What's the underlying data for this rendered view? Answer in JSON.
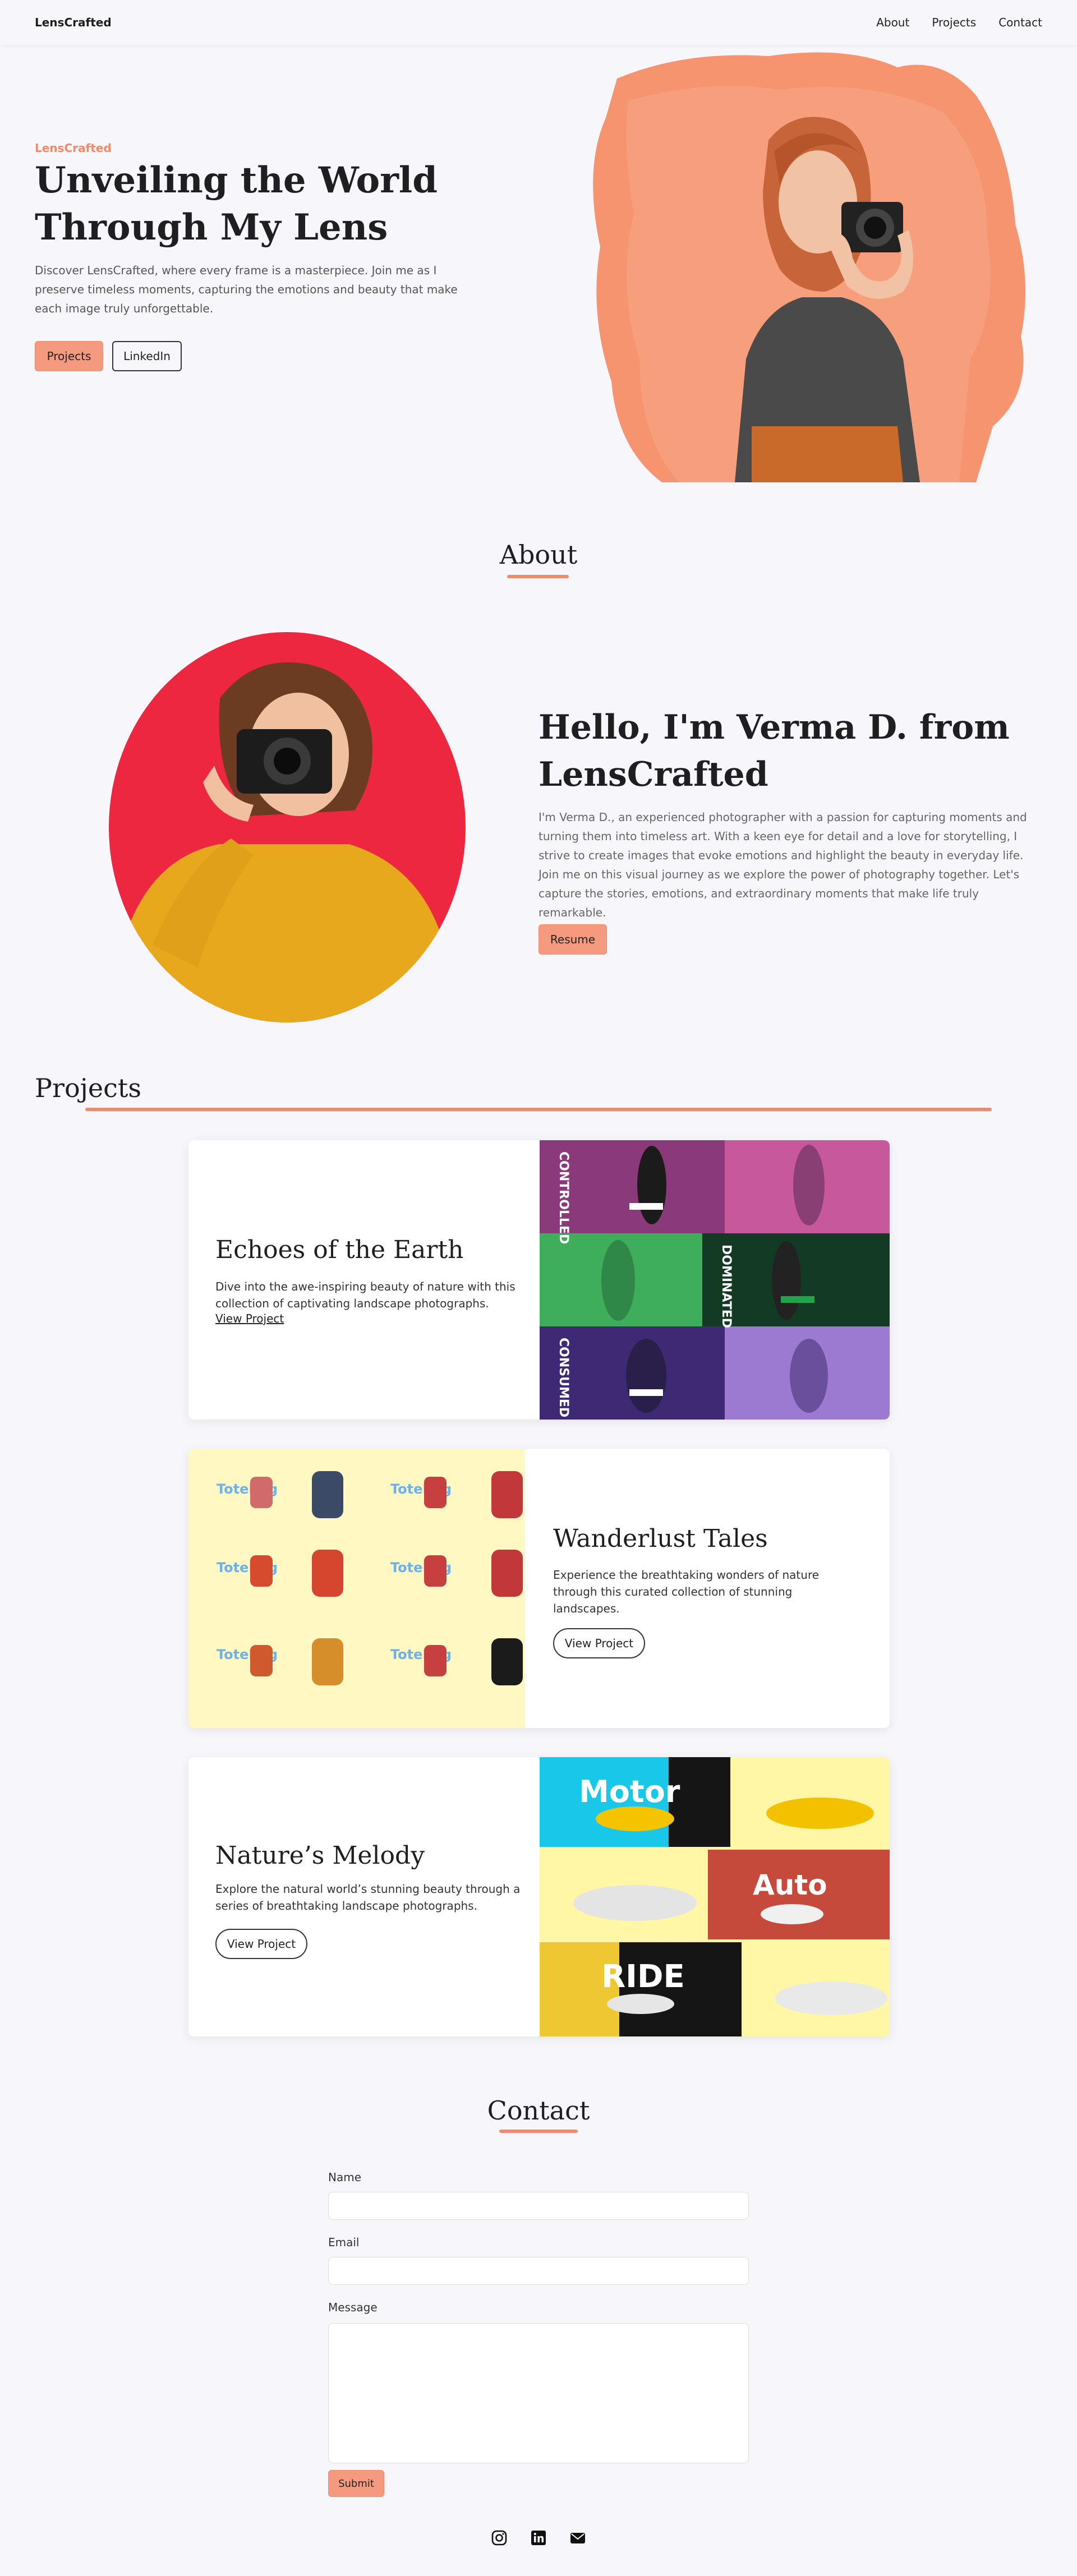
{
  "nav": {
    "logo": "LensCrafted",
    "links": [
      "About",
      "Projects",
      "Contact"
    ]
  },
  "hero": {
    "eyebrow": "LensCrafted",
    "title": "Unveiling the World Through My Lens",
    "description": "Discover LensCrafted, where every frame is a masterpiece. Join me as I preserve timeless moments, capturing the emotions and beauty that make each image truly unforgettable.",
    "primary_button": "Projects",
    "secondary_button": "LinkedIn"
  },
  "about": {
    "section_title": "About",
    "heading": "Hello, I'm Verma D. from LensCrafted",
    "description": "I'm Verma D., an experienced photographer with a passion for capturing moments and turning them into timeless art. With a keen eye for detail and a love for storytelling, I strive to create images that evoke emotions and highlight the beauty in everyday life. Join me on this visual journey as we explore the power of photography together. Let's capture the stories, emotions, and extraordinary moments that make life truly remarkable.",
    "button": "Resume"
  },
  "projects": {
    "section_title": "Projects",
    "items": [
      {
        "title": "Echoes of the Earth",
        "description": "Dive into the awe-inspiring beauty of nature with this collection of captivating landscape photographs.",
        "link": "View Project",
        "image_words": [
          "CONTROLLED",
          "DOMINATED",
          "CONSUMED"
        ]
      },
      {
        "title": "Wanderlust Tales",
        "description": "Experience the breathtaking wonders of nature through this curated collection of stunning landscapes.",
        "link": "View Project",
        "image_words": [
          "ToteBag",
          "ToteBag",
          "ToteBag",
          "ToteBag",
          "ToteBag",
          "ToteBag"
        ]
      },
      {
        "title": "Nature’s Melody",
        "description": "Explore the natural world’s stunning beauty through a series of breathtaking landscape photographs.",
        "link": "View Project",
        "image_words": [
          "Motor",
          "Auto",
          "RIDE"
        ]
      }
    ]
  },
  "contact": {
    "section_title": "Contact",
    "name_label": "Name",
    "email_label": "Email",
    "message_label": "Message",
    "submit": "Submit"
  },
  "footer": {
    "icons": [
      "instagram-icon",
      "linkedin-icon",
      "email-icon"
    ]
  },
  "colors": {
    "accent": "#f08a6e",
    "button": "#f59a7e",
    "background": "#f7f7fb"
  }
}
